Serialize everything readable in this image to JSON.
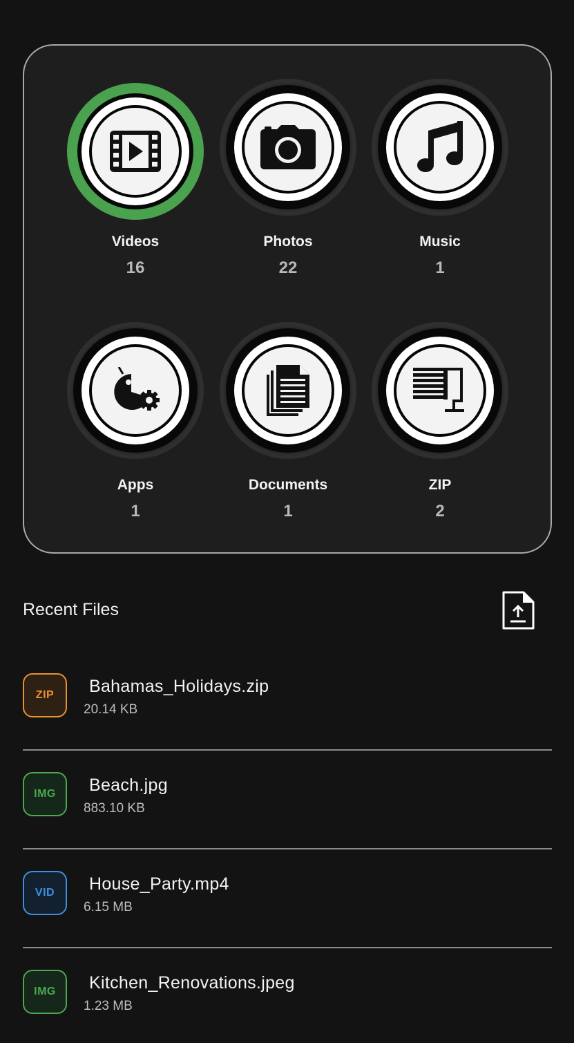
{
  "categories": [
    {
      "label": "Videos",
      "count": "16",
      "icon": "video-icon",
      "active": true
    },
    {
      "label": "Photos",
      "count": "22",
      "icon": "camera-icon",
      "active": false
    },
    {
      "label": "Music",
      "count": "1",
      "icon": "music-note-icon",
      "active": false
    },
    {
      "label": "Apps",
      "count": "1",
      "icon": "android-gear-icon",
      "active": false
    },
    {
      "label": "Documents",
      "count": "1",
      "icon": "documents-icon",
      "active": false
    },
    {
      "label": "ZIP",
      "count": "2",
      "icon": "zip-clamp-icon",
      "active": false
    }
  ],
  "recent": {
    "title": "Recent Files",
    "upload_icon": "file-upload-icon",
    "files": [
      {
        "badge": "ZIP",
        "name": "Bahamas_Holidays.zip",
        "size": "20.14 KB",
        "color": "#e8922f",
        "bg": "#2e2113"
      },
      {
        "badge": "IMG",
        "name": "Beach.jpg",
        "size": "883.10 KB",
        "color": "#4ca94f",
        "bg": "#15261a"
      },
      {
        "badge": "VID",
        "name": "House_Party.mp4",
        "size": "6.15 MB",
        "color": "#3d8fe0",
        "bg": "#13202f"
      },
      {
        "badge": "IMG",
        "name": "Kitchen_Renovations.jpeg",
        "size": "1.23 MB",
        "color": "#4ca94f",
        "bg": "#15261a"
      }
    ]
  },
  "colors": {
    "background": "#131313",
    "card": "#1e1e1f",
    "active_ring": "#4aa24e"
  }
}
